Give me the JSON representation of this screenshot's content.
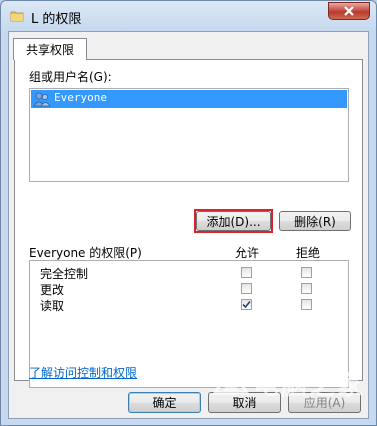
{
  "window": {
    "title": "L 的权限",
    "close_glyph": "✕",
    "folder_icon": "folder-icon"
  },
  "tabs": [
    {
      "label": "共享权限",
      "active": true
    }
  ],
  "users": {
    "group_label": "组或用户名(G):",
    "items": [
      {
        "name": "Everyone",
        "selected": true,
        "icon": "users-group-icon"
      }
    ]
  },
  "buttons": {
    "add": "添加(D)...",
    "remove": "删除(R)",
    "ok": "确定",
    "cancel": "取消",
    "apply": "应用(A)"
  },
  "permissions": {
    "title": "Everyone 的权限(P)",
    "allow_header": "允许",
    "deny_header": "拒绝",
    "rows": [
      {
        "name": "完全控制",
        "allow": false,
        "deny": false
      },
      {
        "name": "更改",
        "allow": false,
        "deny": false
      },
      {
        "name": "读取",
        "allow": true,
        "deny": false
      }
    ]
  },
  "link": "了解访问控制和权限",
  "watermark": "电脑之家",
  "colors": {
    "selection": "#3399ff",
    "highlight_border": "#d9232d",
    "link": "#0066cc"
  }
}
